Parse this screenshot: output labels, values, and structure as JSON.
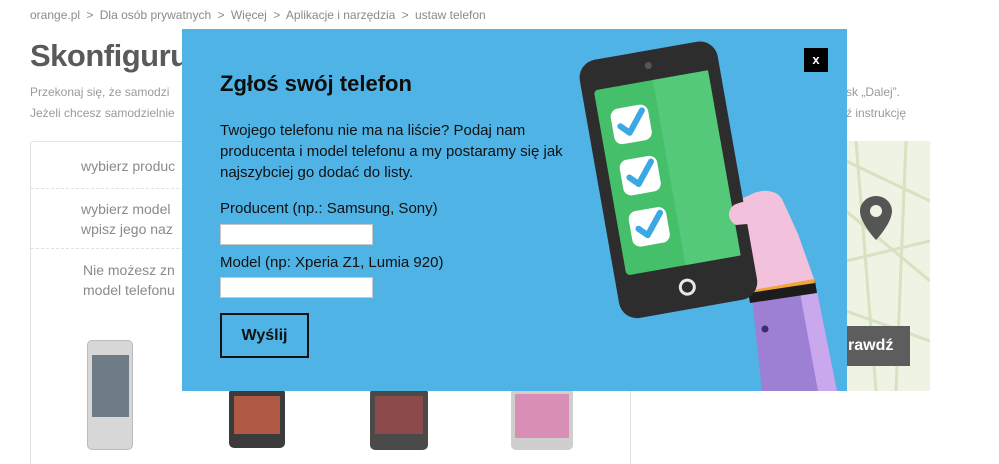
{
  "breadcrumb": {
    "items": [
      "orange.pl",
      "Dla osób prywatnych",
      "Więcej",
      "Aplikacje i narzędzia",
      "ustaw telefon"
    ],
    "separator": ">"
  },
  "page": {
    "title": "Skonfiguru",
    "intro_line1": "Przekonaj się, że samodzi",
    "intro_line2": "Jeżeli chcesz samodzielnie",
    "intro_right1": "sk „Dalej”.",
    "intro_right2": "ź instrukcję"
  },
  "selector": {
    "row1": "wybierz produc",
    "row2_line1": "wybierz model",
    "row2_line2": "wpisz jego naz",
    "row3_line1": "Nie możesz zn",
    "row3_line2": "model telefonu"
  },
  "map": {
    "button_label": "rawdź"
  },
  "modal": {
    "close_label": "x",
    "title": "Zgłoś swój telefon",
    "description": "Twojego telefonu nie ma na liście? Podaj nam producenta i model telefonu a my postaramy się jak najszybciej go dodać do listy.",
    "producer_label": "Producent (np.: Samsung, Sony)",
    "producer_value": "",
    "model_label": "Model (np: Xperia Z1, Lumia 920)",
    "model_value": "",
    "submit_label": "Wyślij"
  },
  "colors": {
    "modal_bg": "#4fb3e6",
    "phone_screen": "#45bf6a",
    "check": "#3aa8e4",
    "sleeve": "#9d7fd3",
    "hand": "#f2c1dc"
  },
  "icons": {
    "map_pin": "map-pin-icon",
    "checkmark": "checkmark-icon"
  }
}
